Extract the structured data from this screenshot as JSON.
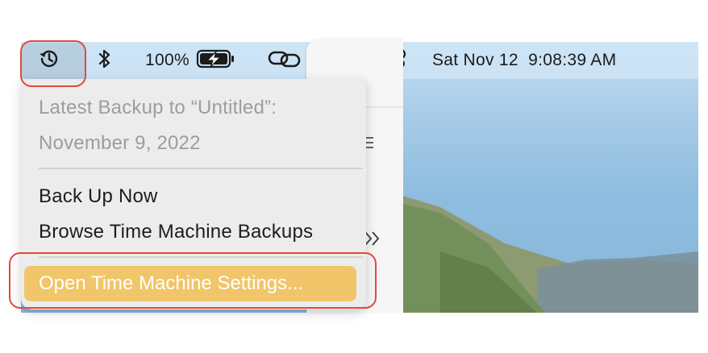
{
  "menubar": {
    "battery_percent": "100%",
    "clock": "Sat Nov 12  9:08:39 AM",
    "icons": [
      "time-machine-icon",
      "bluetooth-icon",
      "battery-charging-icon",
      "link-icon",
      "search-icon",
      "control-center-icon"
    ]
  },
  "menu": {
    "header_line1": "Latest Backup to “Untitled”:",
    "header_line2": "November 9, 2022",
    "items": [
      {
        "label": "Back Up Now"
      },
      {
        "label": "Browse Time Machine Backups"
      }
    ],
    "settings_label": "Open Time Machine Settings..."
  },
  "colors": {
    "highlight": "#f1c569",
    "annotation_ring": "#e0493c",
    "menubar": "#cde4f5"
  }
}
